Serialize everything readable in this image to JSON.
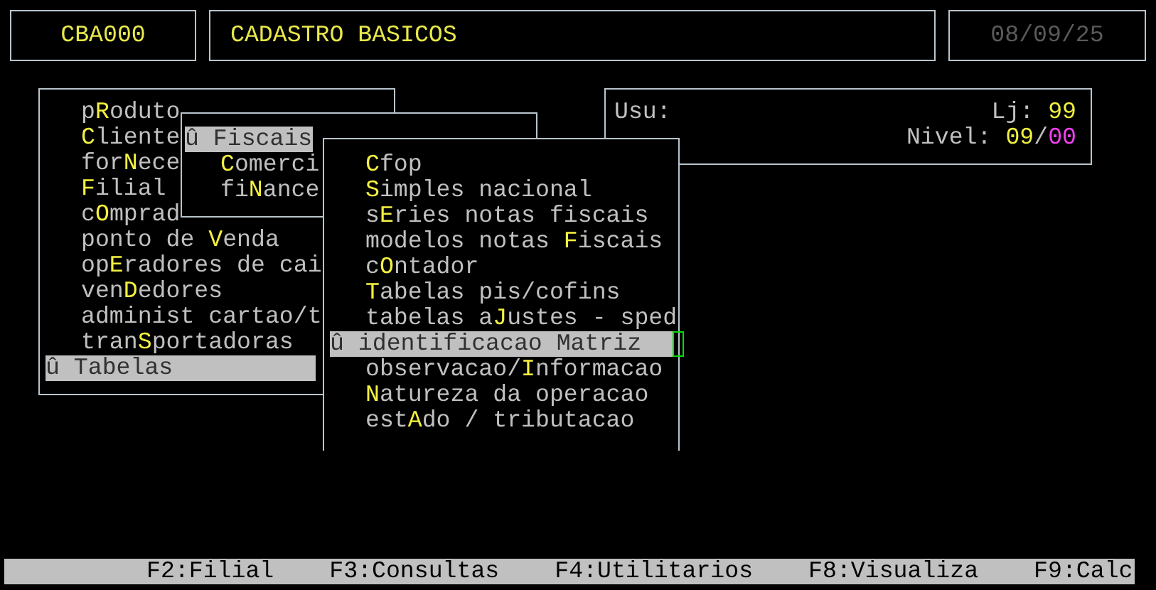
{
  "header": {
    "program_code": "CBA000",
    "title": "CADASTRO BASICOS",
    "date": "08/09/25"
  },
  "info": {
    "user_label": "Usu:",
    "store_label": "Lj:",
    "store": "99",
    "level_label": "Nivel:",
    "level_major": "09",
    "level_separator": "/",
    "level_minor": "00"
  },
  "main_menu": [
    {
      "label": "p**R**oduto",
      "selected": false
    },
    {
      "label": "**C**liente",
      "selected": false
    },
    {
      "label": "for**N**ece",
      "selected": false
    },
    {
      "label": "**F**ilial",
      "selected": false
    },
    {
      "label": "c**O**mprad",
      "selected": false
    },
    {
      "label": "ponto de **V**enda",
      "selected": false
    },
    {
      "label": "op**E**radores de cai",
      "selected": false
    },
    {
      "label": "ven**D**edores",
      "selected": false
    },
    {
      "label": "administ cartao/t",
      "selected": false
    },
    {
      "label": "tran**S**portadoras",
      "selected": false
    },
    {
      "label": "û Tabelas",
      "selected": true
    }
  ],
  "tables_menu": [
    {
      "label": "û Fiscais",
      "selected": true
    },
    {
      "label": "**C**omerci",
      "selected": false
    },
    {
      "label": "fi**N**ance",
      "selected": false
    }
  ],
  "fiscal_menu": [
    {
      "label": "**C**fop",
      "selected": false
    },
    {
      "label": "**S**imples nacional",
      "selected": false
    },
    {
      "label": "s**E**ries notas fiscais",
      "selected": false
    },
    {
      "label": "modelos notas **F**iscais",
      "selected": false
    },
    {
      "label": "c**O**ntador",
      "selected": false
    },
    {
      "label": "**T**abelas pis/cofins",
      "selected": false
    },
    {
      "label": "tabelas a**J**ustes - sped",
      "selected": false
    },
    {
      "label": "û identificacao Matriz",
      "selected": true
    },
    {
      "label": "observacao/**I**nformacao",
      "selected": false
    },
    {
      "label": "**N**atureza da operacao",
      "selected": false
    },
    {
      "label": "est**A**do / tributacao",
      "selected": false
    }
  ],
  "function_keys": [
    "F2:Filial",
    "F3:Consultas",
    "F4:Utilitarios",
    "F8:Visualiza",
    "F9:Calc"
  ]
}
